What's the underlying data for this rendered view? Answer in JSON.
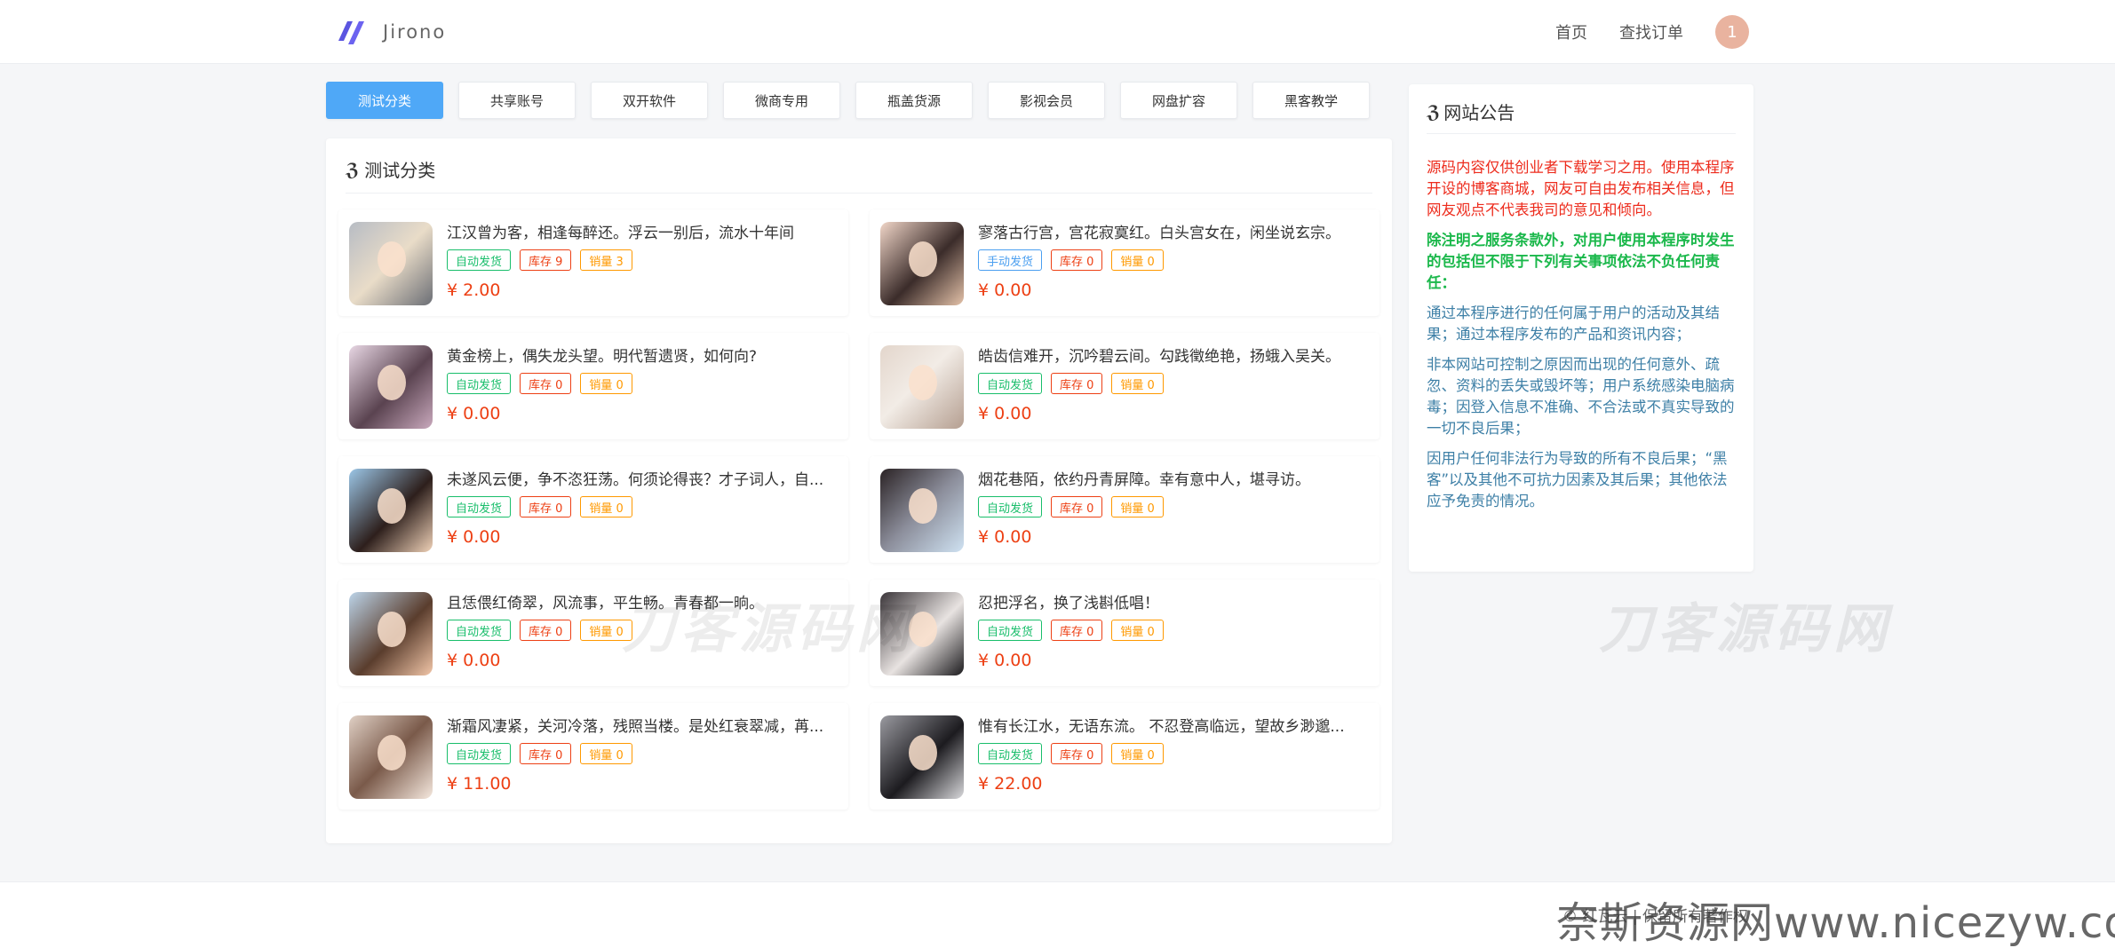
{
  "header": {
    "brand": "Jirono",
    "nav": [
      "首页",
      "查找订单"
    ],
    "avatar_text": "1"
  },
  "categories": [
    "测试分类",
    "共享账号",
    "双开软件",
    "微商专用",
    "瓶盖货源",
    "影视会员",
    "网盘扩容",
    "黑客教学"
  ],
  "active_category": "测试分类",
  "panel": {
    "title": "测试分类",
    "title_icon": "css3-icon"
  },
  "products": [
    {
      "title": "江汉曾为客，相逢每醉还。浮云一别后，流水十年间",
      "delivery": "自动发货",
      "stock": "库存 9",
      "sales": "销量 3",
      "price": "¥ 2.00"
    },
    {
      "title": "寥落古行宫，宫花寂寞红。白头宫女在，闲坐说玄宗。",
      "delivery": "手动发货",
      "stock": "库存 0",
      "sales": "销量 0",
      "price": "¥ 0.00"
    },
    {
      "title": "黄金榜上，偶失龙头望。明代暂遗贤，如何向?",
      "delivery": "自动发货",
      "stock": "库存 0",
      "sales": "销量 0",
      "price": "¥ 0.00"
    },
    {
      "title": "皓齿信难开，沉吟碧云间。勾践徵绝艳，扬蛾入吴关。",
      "delivery": "自动发货",
      "stock": "库存 0",
      "sales": "销量 0",
      "price": "¥ 0.00"
    },
    {
      "title": "未遂风云便，争不恣狂荡。何须论得丧？才子词人，自...",
      "delivery": "自动发货",
      "stock": "库存 0",
      "sales": "销量 0",
      "price": "¥ 0.00"
    },
    {
      "title": "烟花巷陌，依约丹青屏障。幸有意中人，堪寻访。",
      "delivery": "自动发货",
      "stock": "库存 0",
      "sales": "销量 0",
      "price": "¥ 0.00"
    },
    {
      "title": "且恁偎红倚翠，风流事，平生畅。青春都一晌。",
      "delivery": "自动发货",
      "stock": "库存 0",
      "sales": "销量 0",
      "price": "¥ 0.00"
    },
    {
      "title": "忍把浮名，换了浅斟低唱！",
      "delivery": "自动发货",
      "stock": "库存 0",
      "sales": "销量 0",
      "price": "¥ 0.00"
    },
    {
      "title": "渐霜风凄紧，关河冷落，残照当楼。是处红衰翠减，苒...",
      "delivery": "自动发货",
      "stock": "库存 0",
      "sales": "销量 0",
      "price": "¥ 11.00"
    },
    {
      "title": "惟有长江水，无语东流。 不忍登高临远，望故乡渺邈...",
      "delivery": "自动发货",
      "stock": "库存 0",
      "sales": "销量 0",
      "price": "¥ 22.00"
    }
  ],
  "notice": {
    "title": "网站公告",
    "paragraphs": [
      "源码内容仅供创业者下载学习之用。使用本程序开设的博客商城，网友可自由发布相关信息，但网友观点不代表我司的意见和倾向。",
      "除注明之服务条款外，对用户使用本程序时发生的包括但不限于下列有关事项依法不负任何责任：",
      "通过本程序进行的任何属于用户的活动及其结果；通过本程序发布的产品和资讯内容；",
      "非本网站可控制之原因而出现的任何意外、疏忽、资料的丢失或毁坏等；用户系统感染电脑病毒；因登入信息不准确、不合法或不真实导致的一切不良后果；",
      "因用户任何非法行为导致的所有不良后果；“黑客”以及其他不可抗力因素及其后果；其他依法应予免责的情况。"
    ]
  },
  "footer": {
    "copyright": "© 红瓦云  |  保留所有著作权"
  },
  "watermarks": {
    "bottom": "奈斯资源网www.nicezyw.com",
    "mid": "刀客源码网"
  },
  "colors": {
    "accent": "#4fa8f7",
    "price": "#ed4014",
    "auto": "#19be6b",
    "manual": "#4b9ff0",
    "stock": "#ed4014",
    "sales": "#ff9900"
  }
}
